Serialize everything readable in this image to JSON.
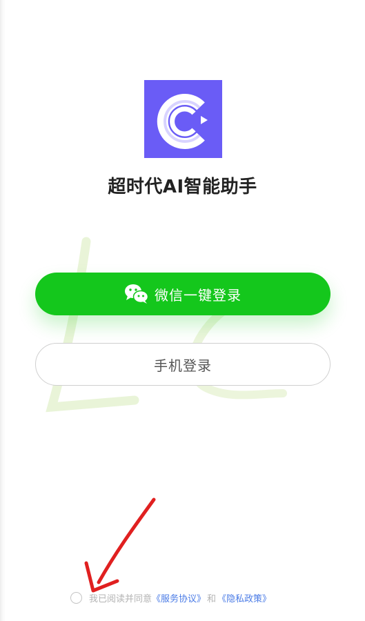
{
  "app": {
    "logo_letter": "C",
    "title": "超时代AI智能助手",
    "brand_color": "#6a5cf6"
  },
  "login": {
    "wechat_label": "微信一键登录",
    "wechat_icon": "wechat-icon",
    "wechat_color": "#14c71c",
    "phone_label": "手机登录"
  },
  "agreement": {
    "checked": false,
    "prefix": "我已阅读并同意",
    "service_link": "《服务协议》",
    "and": "和",
    "privacy_link": "《隐私政策》",
    "link_color": "#4a7be6"
  }
}
